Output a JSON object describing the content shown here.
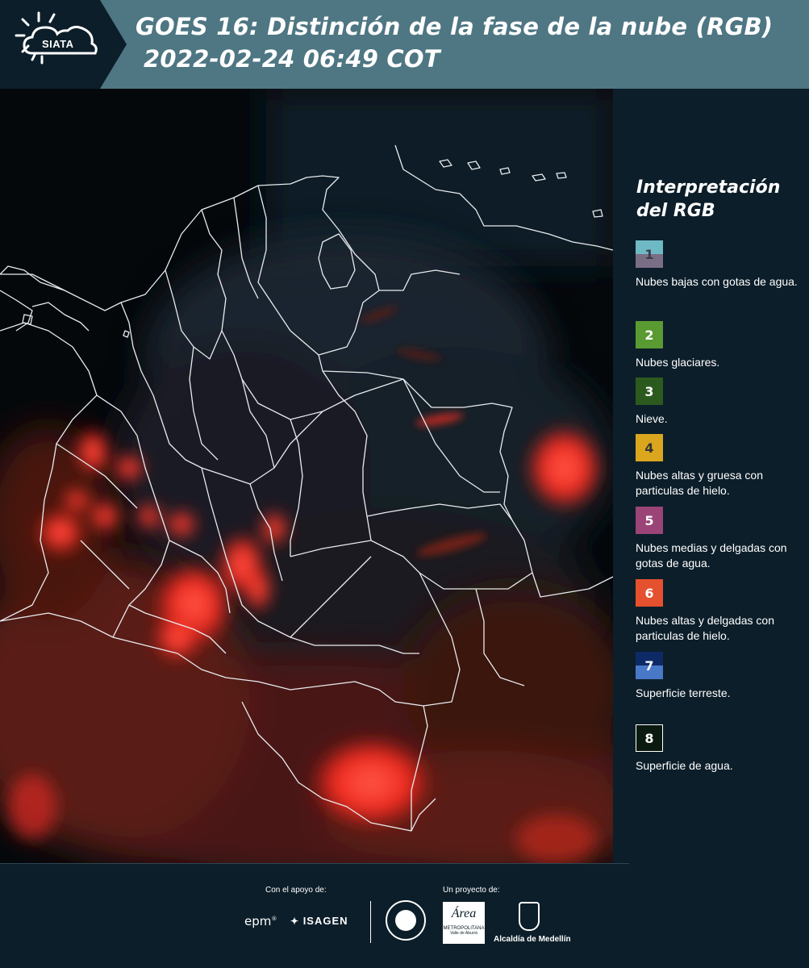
{
  "header": {
    "brand": "SIATA",
    "title_line1": "GOES 16: Distinción de la fase de la nube (RGB)",
    "title_line2": "2022-02-24 06:49 COT"
  },
  "legend": {
    "title_line1": "Interpretación",
    "title_line2": "del RGB",
    "items": [
      {
        "number": "1",
        "label": "Nubes bajas con gotas de agua.",
        "color_top": "#6fb9c4",
        "color_bottom": "#7a6e87",
        "num_color": "#3c3c46"
      },
      {
        "number": "2",
        "label": "Nubes glaciares.",
        "color_top": "#5a9a32",
        "color_bottom": "#5a9a32",
        "num_color": "#ffffff"
      },
      {
        "number": "3",
        "label": "Nieve.",
        "color_top": "#2c5a1e",
        "color_bottom": "#2c5a1e",
        "num_color": "#ffffff"
      },
      {
        "number": "4",
        "label": "Nubes altas y gruesa con particulas de hielo.",
        "color_top": "#d9a61e",
        "color_bottom": "#d9a61e",
        "num_color": "#333333"
      },
      {
        "number": "5",
        "label": "Nubes medias y delgadas con gotas de agua.",
        "color_top": "#9a4478",
        "color_bottom": "#9a4478",
        "num_color": "#ffffff"
      },
      {
        "number": "6",
        "label": "Nubes altas y delgadas con particulas de hielo.",
        "color_top": "#e5502e",
        "color_bottom": "#e5502e",
        "num_color": "#ffffff"
      },
      {
        "number": "7",
        "label": "Superficie terreste.",
        "color_top": "#0e2a66",
        "color_bottom": "#4a78c8",
        "num_color": "#ffffff"
      },
      {
        "number": "8",
        "label": "Superficie de agua.",
        "color_top": "#0a1a10",
        "color_bottom": "#0a1a10",
        "num_color": "#ffffff",
        "border": "#ffffff"
      }
    ]
  },
  "footer": {
    "support_label": "Con el apoyo de:",
    "project_label": "Un proyecto de:",
    "sponsor_epm": "epm",
    "sponsor_isagen": "ISAGEN",
    "sponsor_area_line1": "Área",
    "sponsor_area_line2": "METROPOLITANA",
    "sponsor_area_line3": "Valle de Aburrá",
    "sponsor_alcaldia": "Alcaldía de Medellín"
  }
}
